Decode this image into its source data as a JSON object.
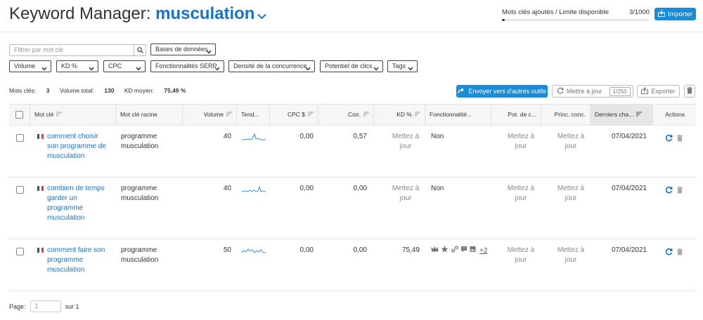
{
  "header": {
    "title_prefix": "Keyword Manager:",
    "title_keyword": "musculation",
    "limit_label": "Mots clés ajoutés / Limite disponible",
    "limit_count": "3/1000",
    "limit_progress": 0.003,
    "import_label": "Importer"
  },
  "filters": {
    "search_placeholder": "Filtrer par mot clé",
    "databases": "Bases de données",
    "volume": "Volume",
    "kd": "KD %",
    "cpc": "CPC",
    "serp": "Fonctionnalités SERP",
    "competition": "Densité de la concurrence",
    "clicks": "Potentiel de clics",
    "tags": "Tags"
  },
  "summary": {
    "keywords_label": "Mots clés:",
    "keywords_value": "3",
    "volume_label": "Volume total:",
    "volume_value": "130",
    "kd_label": "KD moyen:",
    "kd_value": "75,49 %"
  },
  "toolbar": {
    "send_label": "Envoyer vers d'autres outils",
    "update_label": "Mettre à jour",
    "update_count": "1/250",
    "export_label": "Exporter"
  },
  "columns": {
    "keyword": "Mot clé",
    "root": "Mot clé racine",
    "volume": "Volume",
    "trend": "Tend...",
    "cpc": "CPC $",
    "com": "Con.",
    "kd": "KD %",
    "serp": "Fonctionnalité...",
    "potential": "Pot. de c...",
    "competitor": "Princ. conc.",
    "last": "Derniers cha...",
    "actions": "Actions"
  },
  "rows": [
    {
      "keyword_lines": [
        "comment choisir",
        "son programme de",
        "musculation"
      ],
      "root_lines": [
        "programme",
        "musculation"
      ],
      "volume": "40",
      "cpc": "0,00",
      "com": "0,57",
      "kd_lines": [
        "Mettez à",
        "jour"
      ],
      "serp": "Non",
      "potential_lines": [
        "Mettez à",
        "jour"
      ],
      "competitor_lines": [
        "Mettez à",
        "jour"
      ],
      "last": "07/04/2021"
    },
    {
      "keyword_lines": [
        "combien de temps",
        "garder un",
        "programme",
        "musculation"
      ],
      "root_lines": [
        "programme",
        "musculation"
      ],
      "volume": "40",
      "cpc": "0,00",
      "com": "0,00",
      "kd_lines": [
        "Mettez à",
        "jour"
      ],
      "serp": "Non",
      "potential_lines": [
        "Mettez à",
        "jour"
      ],
      "competitor_lines": [
        "Mettez à",
        "jour"
      ],
      "last": "07/04/2021"
    },
    {
      "keyword_lines": [
        "comment faire son",
        "programme",
        "musculation"
      ],
      "root_lines": [
        "programme",
        "musculation"
      ],
      "volume": "50",
      "cpc": "0,00",
      "com": "0,00",
      "kd": "75,49",
      "serp_more": "+2",
      "potential_lines": [
        "Mettez à",
        "jour"
      ],
      "competitor_lines": [
        "Mettez à",
        "jour"
      ],
      "last": "07/04/2021"
    }
  ],
  "pager": {
    "label": "Page:",
    "placeholder": "1",
    "of_label": "sur 1"
  },
  "colors": {
    "accent": "#1a8cd8",
    "link": "#1a73c8",
    "trend": "#3d8fd6"
  }
}
